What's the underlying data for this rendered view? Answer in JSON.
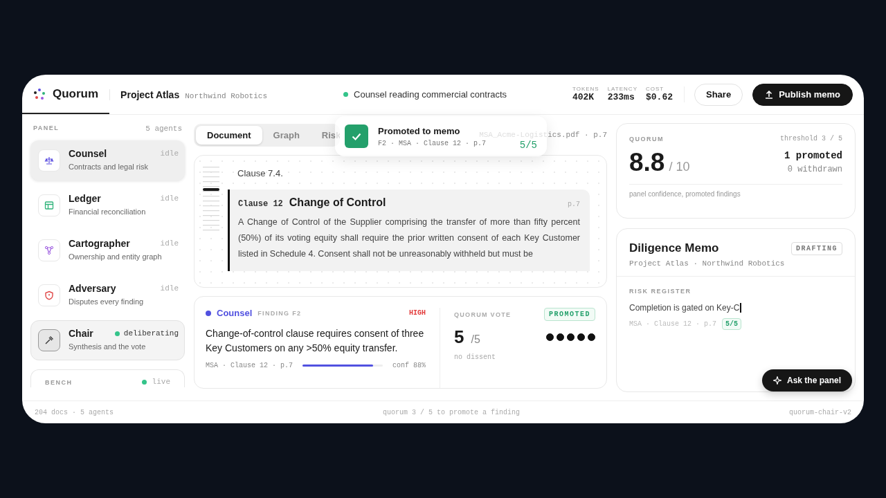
{
  "app": {
    "name": "Quorum"
  },
  "project": {
    "name": "Project Atlas",
    "client": "Northwind Robotics"
  },
  "status": {
    "text": "Counsel reading commercial contracts",
    "live": true
  },
  "metrics": [
    {
      "label": "TOKENS",
      "value": "402K"
    },
    {
      "label": "LATENCY",
      "value": "233ms"
    },
    {
      "label": "COST",
      "value": "$0.62"
    }
  ],
  "actions": [
    {
      "label": "Share",
      "kind": "secondary"
    },
    {
      "label": "Publish memo",
      "kind": "primary"
    }
  ],
  "sidebar": {
    "title": "PANEL",
    "count": "5 agents",
    "agents": [
      {
        "name": "Counsel",
        "description": "Contracts and legal risk",
        "status": "idle",
        "active": false,
        "selected": false,
        "hovered": true
      },
      {
        "name": "Ledger",
        "description": "Financial reconciliation",
        "status": "idle",
        "active": false,
        "selected": false,
        "hovered": false
      },
      {
        "name": "Cartographer",
        "description": "Ownership and entity graph",
        "status": "idle",
        "active": false,
        "selected": false,
        "hovered": false
      },
      {
        "name": "Adversary",
        "description": "Disputes every finding",
        "status": "idle",
        "active": false,
        "selected": false,
        "hovered": false
      },
      {
        "name": "Chair",
        "description": "Synthesis and the vote",
        "status": "deliberating",
        "active": true,
        "selected": true,
        "hovered": false
      }
    ],
    "bench": {
      "title": "BENCH",
      "status": "live",
      "live": true
    }
  },
  "tabs": [
    {
      "label": "Document",
      "selected": true
    },
    {
      "label": "Graph",
      "selected": false
    },
    {
      "label": "Risk",
      "selected": false
    }
  ],
  "document": {
    "file": "MSA_Acme-Logistics.pdf · p.7",
    "previous": "Clause 7.4.",
    "clause": {
      "number": "Clause 12",
      "title": "Change of Control",
      "page": "p.7",
      "text": "A Change of Control of the Supplier comprising the transfer of more than fifty percent (50%) of its voting equity shall require the prior written consent of each Key Customer listed in Schedule 4. Consent shall not be unreasonably withheld but must be"
    }
  },
  "toast": {
    "title": "Promoted to memo",
    "meta": "F2 · MSA · Clause 12 · p.7",
    "score": "5/5"
  },
  "finding": {
    "agent": "Counsel",
    "label": "FINDING F2",
    "severity": "HIGH",
    "text": "Change-of-control clause requires consent of three Key Customers on any >50% equity transfer.",
    "source": "MSA · Clause 12 · p.7",
    "level": 0.88,
    "confidence": "conf 88%"
  },
  "vote": {
    "title": "QUORUM VOTE",
    "status": "PROMOTED",
    "score": "5",
    "total": "/5",
    "note": "no dissent",
    "ballots": [
      {
        "approve": true
      },
      {
        "approve": true
      },
      {
        "approve": true
      },
      {
        "approve": true
      },
      {
        "approve": true
      }
    ]
  },
  "quorum": {
    "title": "QUORUM",
    "threshold": "threshold 3 / 5",
    "score": "8.8",
    "scale": "/ 10",
    "promoted": "1 promoted",
    "withdrawn": "0 withdrawn",
    "caption": "panel confidence, promoted findings"
  },
  "memo": {
    "title": "Diligence Memo",
    "status": "DRAFTING",
    "subtitle": "Project Atlas · Northwind Robotics",
    "section": "RISK REGISTER",
    "entry": {
      "text": "Completion is gated on Key-C",
      "typing": true,
      "source": "MSA · Clause 12 · p.7",
      "score": "5/5"
    },
    "ask": "Ask the panel"
  },
  "footer": [
    "204 docs · 5 agents",
    "quorum 3 / 5 to promote a finding",
    "quorum-chair-v2"
  ]
}
